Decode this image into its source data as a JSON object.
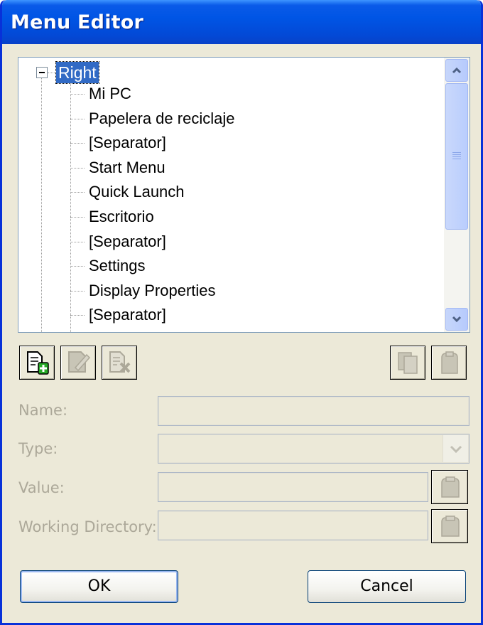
{
  "window": {
    "title": "Menu Editor"
  },
  "tree": {
    "root": "Right",
    "items": [
      "Mi PC",
      "Papelera de reciclaje",
      "[Separator]",
      "Start Menu",
      "Quick Launch",
      "Escritorio",
      "[Separator]",
      "Settings",
      "Display Properties",
      "[Separator]"
    ]
  },
  "toolbar": {
    "icons": [
      "add-item-icon",
      "edit-item-icon",
      "delete-item-icon",
      "copy-icon",
      "paste-icon"
    ]
  },
  "form": {
    "name_label": "Name:",
    "type_label": "Type:",
    "value_label": "Value:",
    "workdir_label": "Working Directory:",
    "name_value": "",
    "type_value": "",
    "value_value": "",
    "workdir_value": ""
  },
  "buttons": {
    "ok": "OK",
    "cancel": "Cancel"
  },
  "colors": {
    "titlebar": "#0055e5",
    "selection": "#316ac5",
    "dialog_bg": "#ece9d8",
    "disabled_text": "#aca899"
  }
}
